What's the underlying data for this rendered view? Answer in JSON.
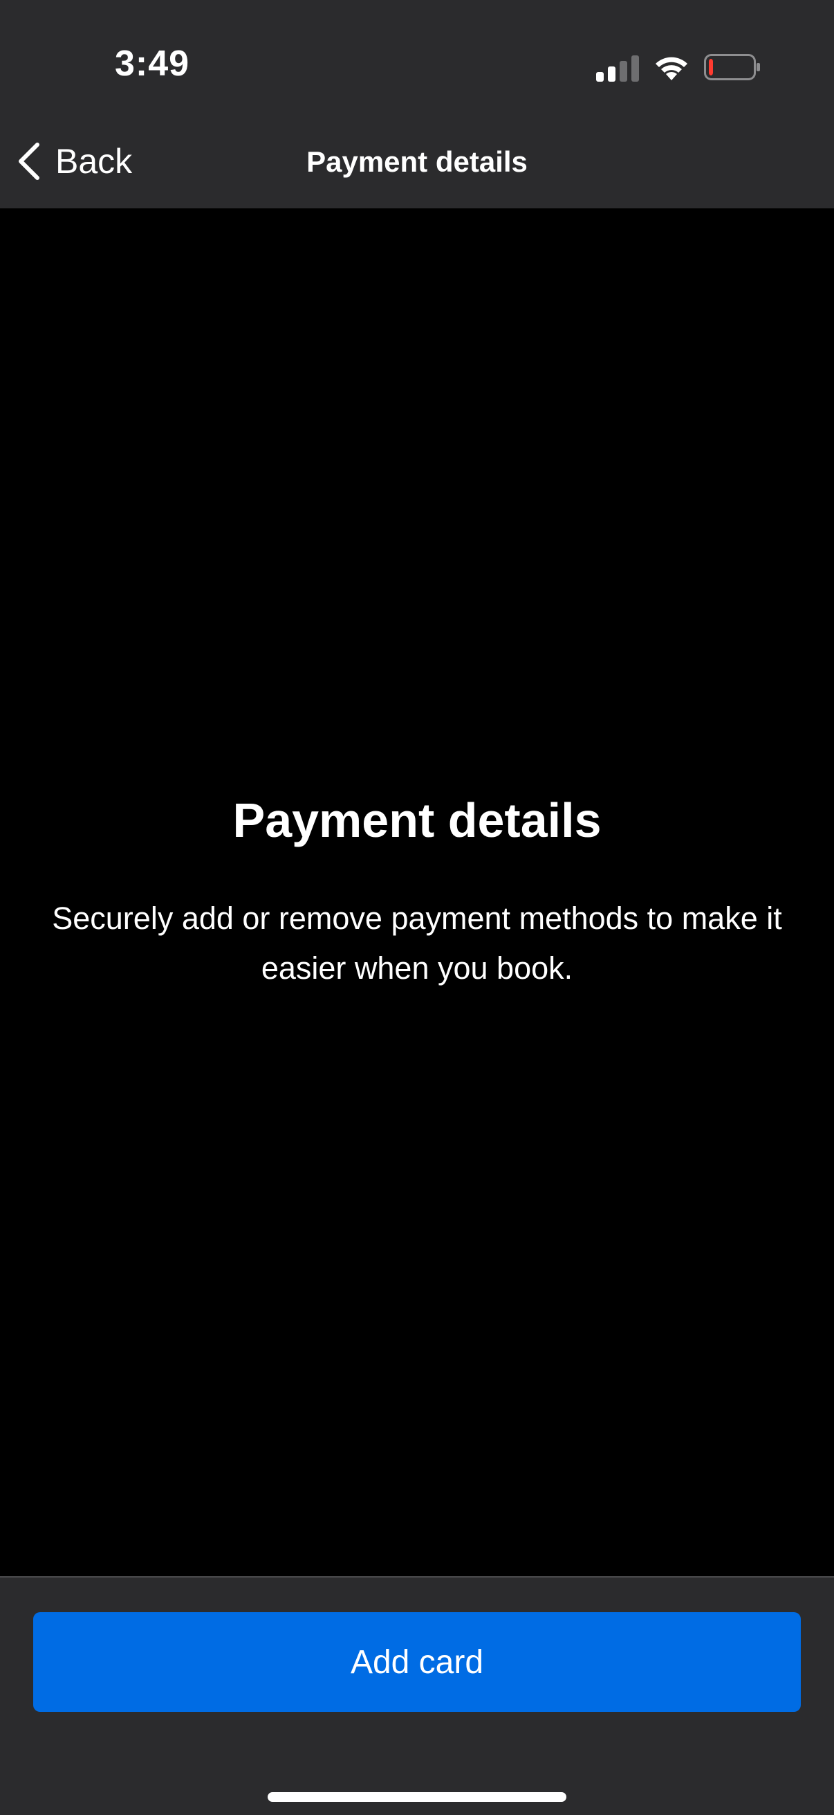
{
  "status_bar": {
    "time": "3:49",
    "icons": {
      "signal": "cellular-signal-icon",
      "wifi": "wifi-icon",
      "battery": "battery-low-icon"
    },
    "battery_level_fraction": 0.1,
    "battery_color": "#ff3b30"
  },
  "nav": {
    "back_label": "Back",
    "title": "Payment details"
  },
  "main": {
    "title": "Payment details",
    "description": "Securely add or remove payment methods to make it easier when you book."
  },
  "footer": {
    "add_card_label": "Add card"
  },
  "colors": {
    "header_bg": "#2b2b2d",
    "content_bg": "#000000",
    "accent": "#006ce4",
    "text": "#ffffff"
  }
}
